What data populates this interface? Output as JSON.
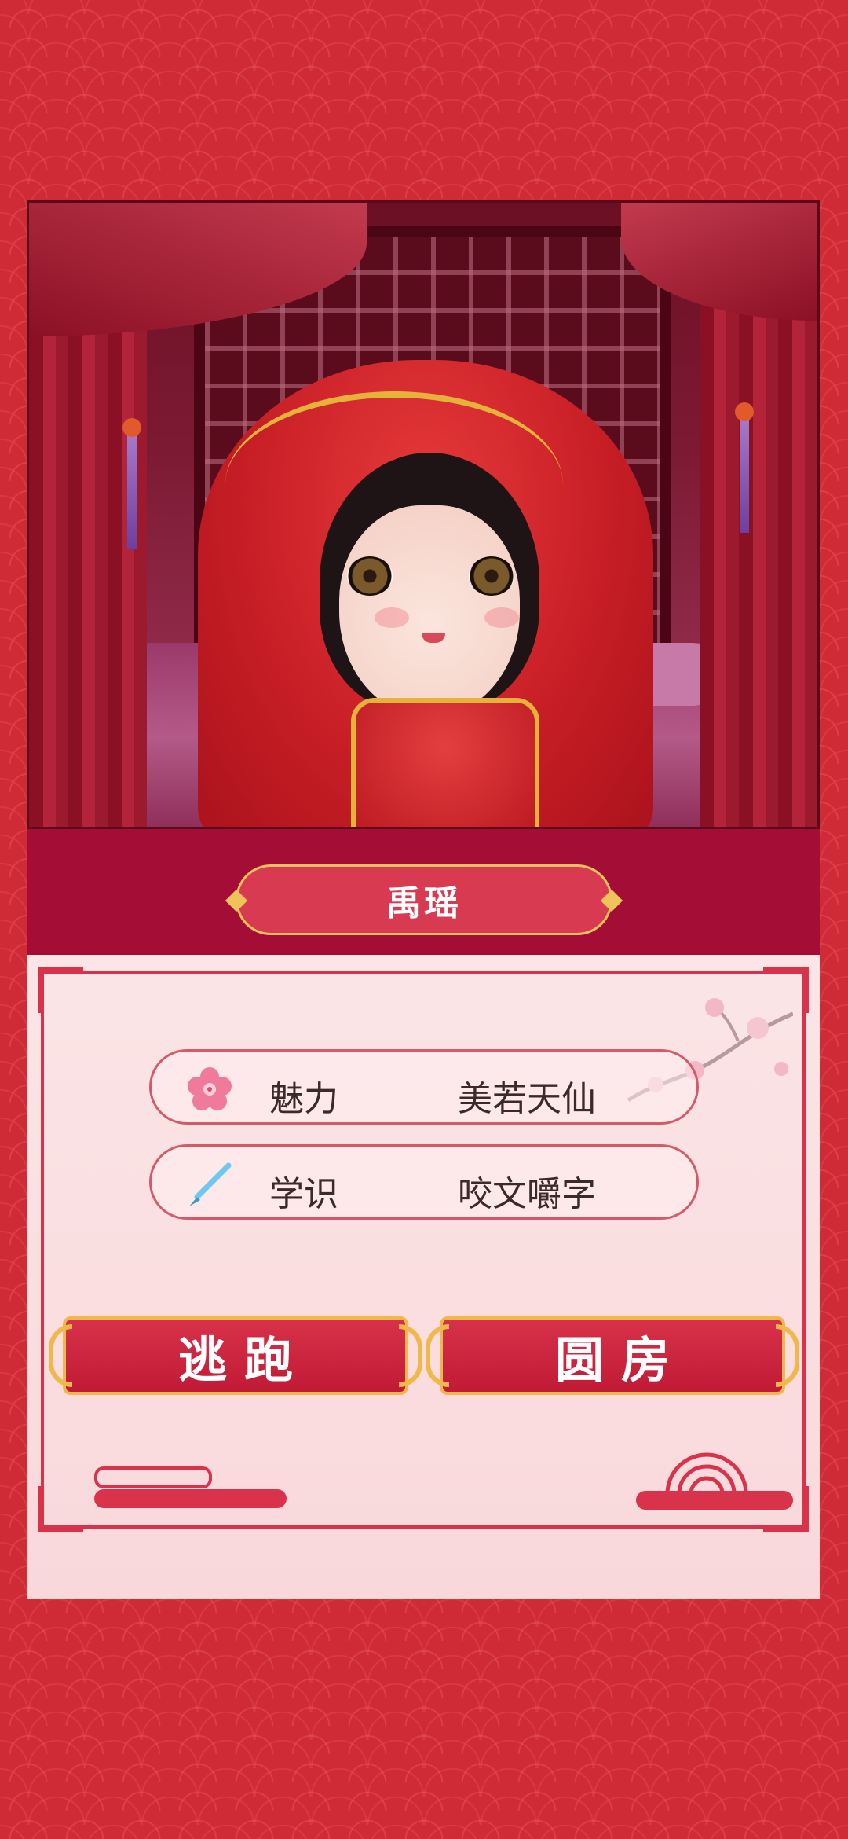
{
  "character": {
    "name": "禹瑶"
  },
  "stats": [
    {
      "icon": "plum-blossom-icon",
      "label": "魅力",
      "value": "美若天仙"
    },
    {
      "icon": "brush-icon",
      "label": "学识",
      "value": "咬文嚼字"
    }
  ],
  "actions": {
    "escape_label": "逃跑",
    "consummate_label": "圆房"
  },
  "colors": {
    "background": "#cf2b36",
    "name_band": "#a40d35",
    "panel": "#fbe5e6",
    "button": "#c11a36",
    "gold": "#f0b84a"
  }
}
